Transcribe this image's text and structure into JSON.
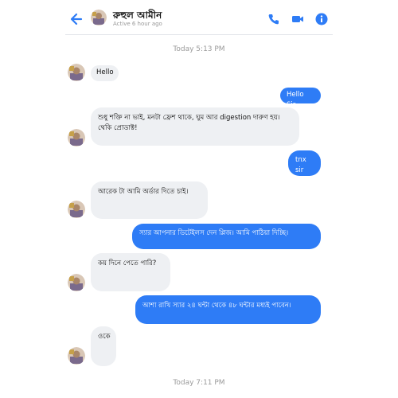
{
  "header": {
    "contact_name": "রুহুল আমীন",
    "status": "Active 6 hour ago",
    "icons": [
      "back-arrow-icon",
      "phone-icon",
      "video-icon",
      "info-icon"
    ],
    "accent_color": "#2e7cf6"
  },
  "timestamps": {
    "first": "Today 5:13 PM",
    "last": "Today 7:11 PM"
  },
  "messages": [
    {
      "from": "them",
      "text": "Hello"
    },
    {
      "from": "me",
      "text": "Hello Sir"
    },
    {
      "from": "them",
      "text": "শুধু শক্তি না ভাই, মনটা ফ্রেশ থাকে, ঘুম আর digestion দারুণ হয়। থেকি প্রোডাক্ট!"
    },
    {
      "from": "me",
      "text": "tnx sir"
    },
    {
      "from": "them",
      "text": "আরেক টা আমি অর্ডার দিতে চাই।"
    },
    {
      "from": "me",
      "text": "স্যার আপনার ডিটেইলস দেন প্লিজ। আমি পাঠিয়া দিচ্ছি।"
    },
    {
      "from": "them",
      "text": "কয় দিনে পেতে পারি?"
    },
    {
      "from": "me",
      "text": "আশা রাখি স্যার ২৪ ঘন্টা থেকে ৪৮ ঘন্টার মধ্যই পাবেন।"
    },
    {
      "from": "them",
      "text": "ওকে"
    }
  ]
}
